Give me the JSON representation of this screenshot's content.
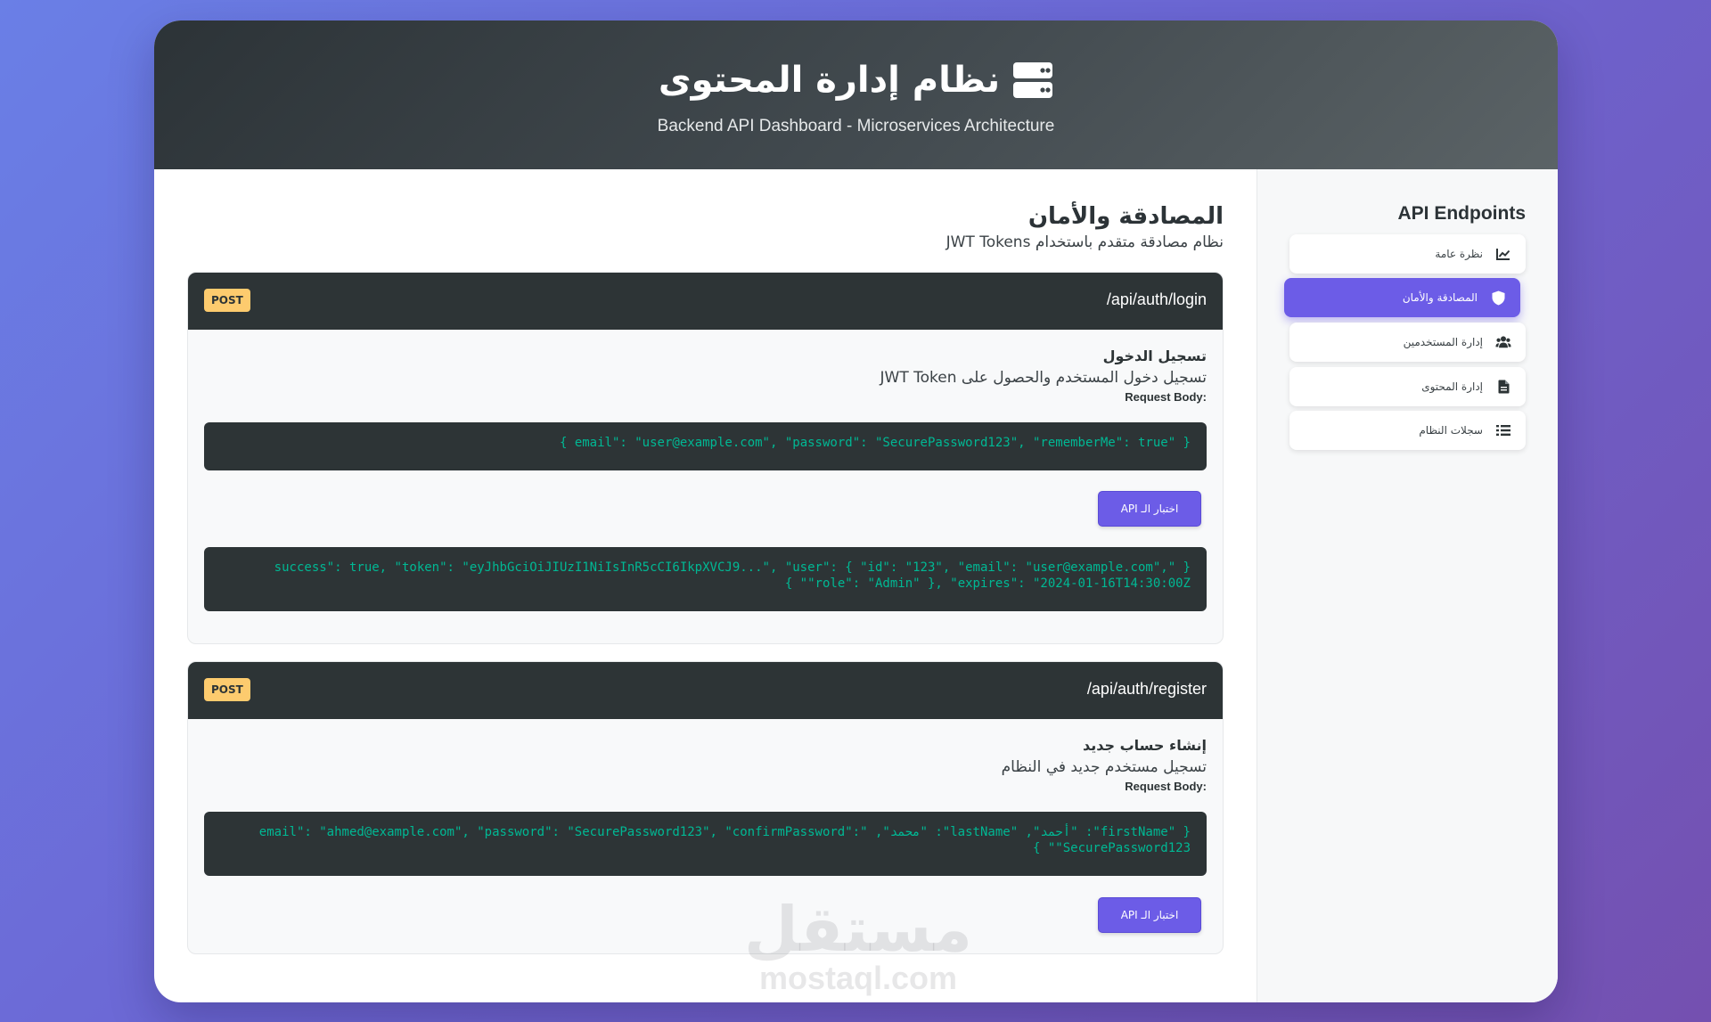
{
  "header": {
    "title": "نظام إدارة المحتوى",
    "subtitle": "Backend API Dashboard - Microservices Architecture",
    "icon": "server-icon"
  },
  "sidebar": {
    "title": "API Endpoints",
    "items": [
      {
        "label": "نظرة عامة",
        "icon": "chart-line-icon",
        "active": false
      },
      {
        "label": "المصادقة والأمان",
        "icon": "shield-icon",
        "active": true
      },
      {
        "label": "إدارة المستخدمين",
        "icon": "users-icon",
        "active": false
      },
      {
        "label": "إدارة المحتوى",
        "icon": "file-icon",
        "active": false
      },
      {
        "label": "سجلات النظام",
        "icon": "list-icon",
        "active": false
      }
    ]
  },
  "section": {
    "title": "المصادقة والأمان",
    "subtitle": "نظام مصادقة متقدم باستخدام JWT Tokens"
  },
  "endpoints": [
    {
      "method": "POST",
      "path": "/api/auth/login",
      "name": "تسجيل الدخول",
      "description": "تسجيل دخول المستخدم والحصول على JWT Token",
      "request_label": "Request Body:",
      "request_body": "{ \"email\": \"user@example.com\", \"password\": \"SecurePassword123\", \"rememberMe\": true }",
      "test_label": "اختبار الـ API",
      "response_body": "{ \"success\": true, \"token\": \"eyJhbGciOiJIUzI1NiIsInR5cCI6IkpXVCJ9...\", \"user\": { \"id\": \"123\", \"email\": \"user@example.com\", \"role\": \"Admin\" }, \"expires\": \"2024-01-16T14:30:00Z\" }"
    },
    {
      "method": "POST",
      "path": "/api/auth/register",
      "name": "إنشاء حساب جديد",
      "description": "تسجيل مستخدم جديد في النظام",
      "request_label": "Request Body:",
      "request_body": "{ \"firstName\": \"أحمد\", \"lastName\": \"محمد\", \"email\": \"ahmed@example.com\", \"password\": \"SecurePassword123\", \"confirmPassword\": \"SecurePassword123\" }",
      "test_label": "اختبار الـ API"
    }
  ],
  "watermark": {
    "arabic": "مستقل",
    "latin": "mostaql.com"
  },
  "colors": {
    "accent": "#6c5ce7",
    "header_dark": "#2d3436",
    "method_post": "#fdcb6e",
    "code_text": "#00b894"
  }
}
